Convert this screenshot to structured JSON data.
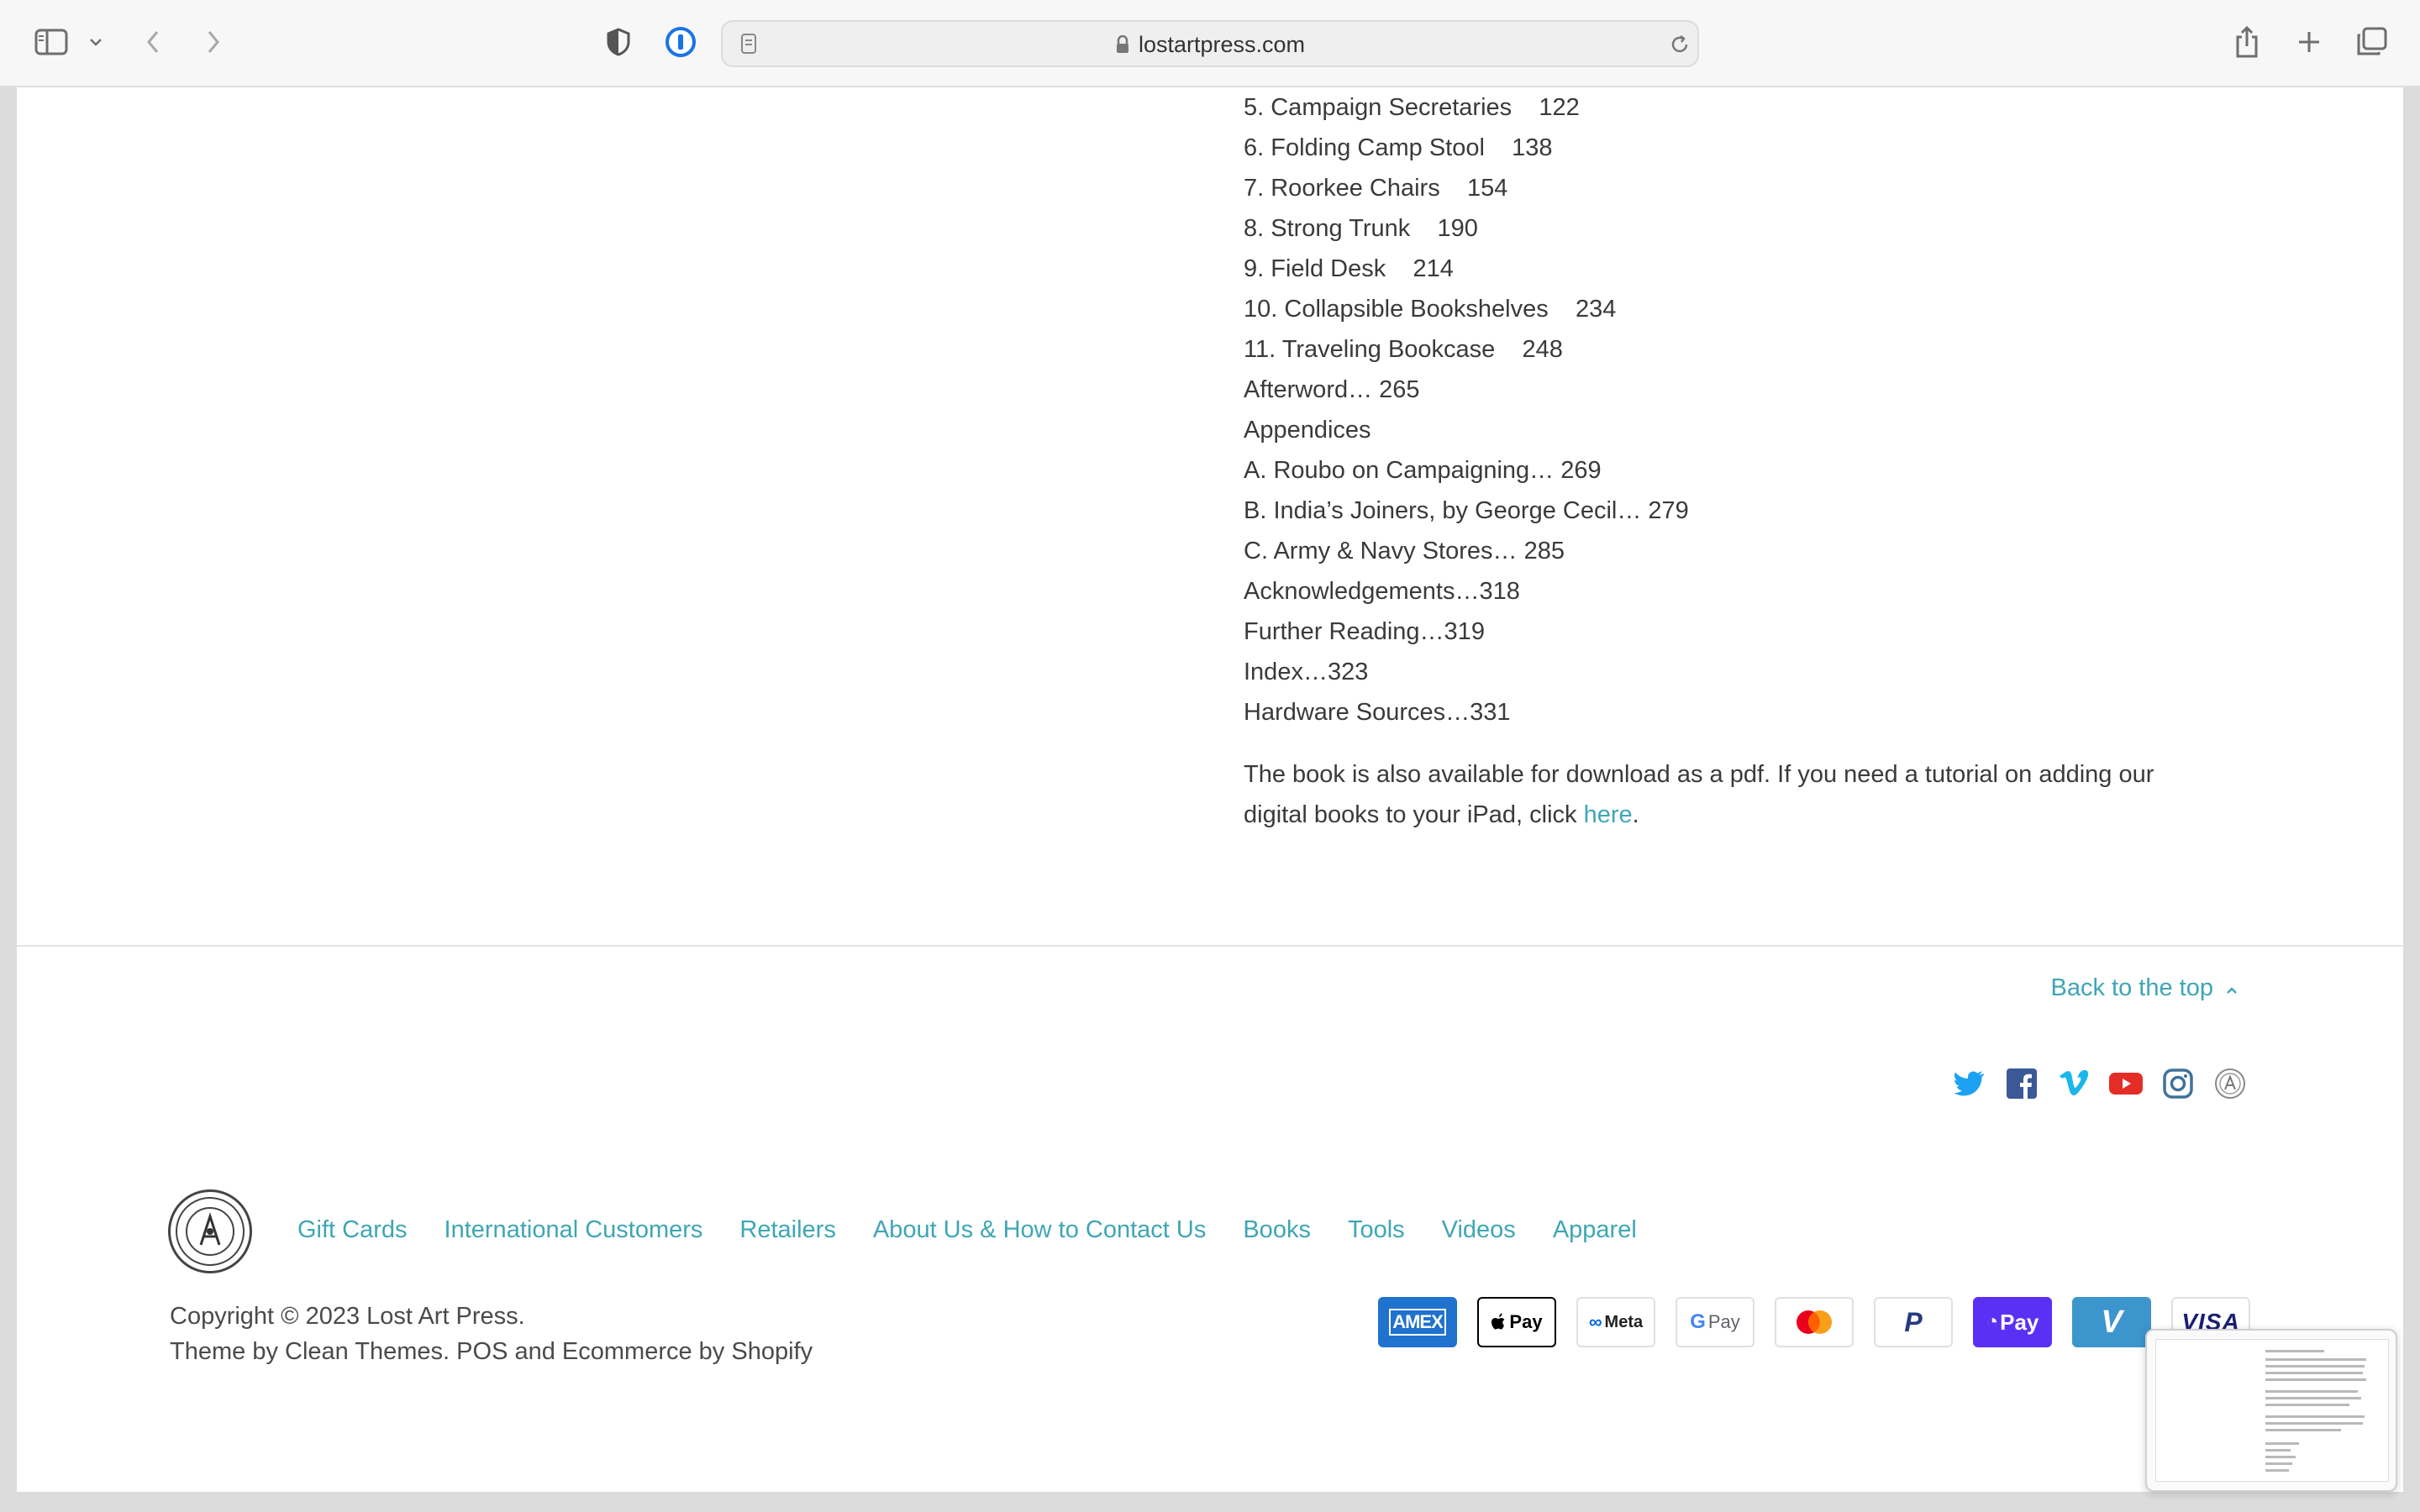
{
  "browser": {
    "url": "lostartpress.com"
  },
  "toc": [
    "5. Campaign Secretaries    122",
    "6. Folding Camp Stool    138",
    "7. Roorkee Chairs    154",
    "8. Strong Trunk    190",
    "9. Field Desk    214",
    "10. Collapsible Bookshelves    234",
    "11. Traveling Bookcase    248",
    "Afterword… 265",
    "Appendices",
    "A. Roubo on Campaigning… 269",
    "B. India’s Joiners, by George Cecil… 279",
    "C. Army & Navy Stores… 285",
    "Acknowledgements…318",
    "Further Reading…319",
    "Index…323",
    "Hardware Sources…331"
  ],
  "paragraph": {
    "line1": "The book is also available for download as a pdf. If you need a tutorial on adding our",
    "line2_before": "digital books to your iPad, click ",
    "link": "here",
    "line2_after": "."
  },
  "back_to_top": "Back to the top",
  "social": [
    "twitter-icon",
    "facebook-icon",
    "vimeo-icon",
    "youtube-icon",
    "instagram-icon",
    "lost-art-press-icon"
  ],
  "footer": {
    "nav": [
      "Gift Cards",
      "International Customers",
      "Retailers",
      "About Us & How to Contact Us",
      "Books",
      "Tools",
      "Videos",
      "Apparel"
    ],
    "copyright": "Copyright © 2023 Lost Art Press.",
    "theme": "Theme by Clean Themes. POS and Ecommerce by Shopify"
  },
  "payments": [
    {
      "name": "AMEX",
      "bg": "#1f72cd",
      "color": "#ffffff"
    },
    {
      "name": "Pay",
      "bg": "#ffffff",
      "color": "#000000"
    },
    {
      "name": "Meta",
      "bg": "#ffffff",
      "color": "#222222"
    },
    {
      "name": "Pay",
      "bg": "#ffffff",
      "color": "#5f6368"
    },
    {
      "name": "",
      "bg": "#ffffff",
      "color": "#000000"
    },
    {
      "name": "P",
      "bg": "#ffffff",
      "color": "#253b80"
    },
    {
      "name": "Pay",
      "bg": "#5a31f4",
      "color": "#ffffff"
    },
    {
      "name": "V",
      "bg": "#3d95ce",
      "color": "#ffffff"
    },
    {
      "name": "VISA",
      "bg": "#ffffff",
      "color": "#1a1f71"
    }
  ],
  "colors": {
    "link": "#3ea6b5",
    "text": "#3a3a3a"
  }
}
